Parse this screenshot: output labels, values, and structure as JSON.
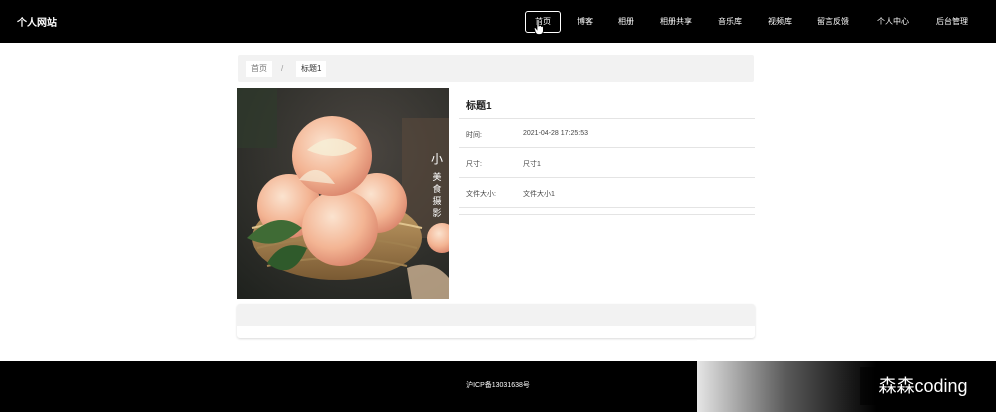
{
  "site": {
    "brand": "个人网站"
  },
  "nav": {
    "items": [
      {
        "label": "首页",
        "active": true
      },
      {
        "label": "博客"
      },
      {
        "label": "相册"
      },
      {
        "label": "相册共享"
      },
      {
        "label": "音乐库"
      },
      {
        "label": "视频库"
      },
      {
        "label": "留言反馈"
      },
      {
        "label": "个人中心"
      },
      {
        "label": "后台管理"
      }
    ]
  },
  "breadcrumb": {
    "home": "首页",
    "separator": "/",
    "current": "标题1"
  },
  "photo": {
    "vertical_caption": "小 美食 摄影"
  },
  "detail": {
    "title": "标题1",
    "rows": [
      {
        "key": "时间:",
        "value": "2021-04-28 17:25:53"
      },
      {
        "key": "尺寸:",
        "value": "尺寸1"
      },
      {
        "key": "文件大小:",
        "value": "文件大小1"
      }
    ]
  },
  "footer": {
    "icp": "沪ICP备13031638号"
  },
  "watermark": "森森coding",
  "colors": {
    "topbar": "#000000",
    "footer": "#000000",
    "panel": "#f2f2f2"
  }
}
